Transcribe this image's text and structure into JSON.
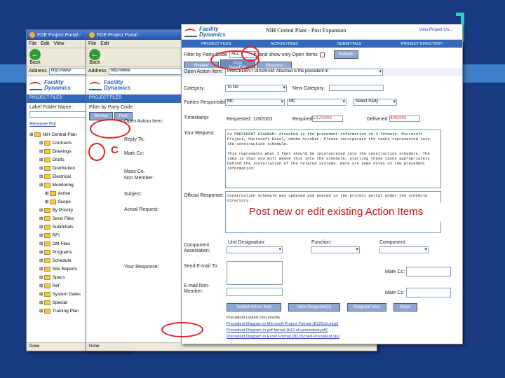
{
  "win1": {
    "title": "FDE Project Portal -",
    "menu": [
      "File",
      "Edit",
      "View"
    ],
    "back": "Back",
    "address": "Address",
    "url": "http://www",
    "logo1": "Facility",
    "logo2": "Dynamics",
    "nav": "PROJECT FILES",
    "label_folder": "Label Folder Name :",
    "remove": "Remove Fol",
    "tree": [
      "NIH Central Plan",
      "Contracts",
      "Drawings",
      "Drafts",
      "Distribution",
      "Electrical",
      "Monitoring",
      "Active",
      "Scope",
      "By Priority",
      "Send Files",
      "Submittals",
      "RFI",
      "DM Files",
      "Programs",
      "Schedule",
      "Site Reports",
      "Specs",
      "Ref",
      "System Dates",
      "Special",
      "Training Plan"
    ],
    "status": "Done"
  },
  "win2": {
    "title": "FDE Project Portal -",
    "menu": [
      "File",
      "Edit"
    ],
    "back": "Back",
    "address": "Address",
    "url": "http://www",
    "logo1": "Facility",
    "logo2": "Dynamics",
    "nav": "PROJECT FILES",
    "filter": "Filter by Party Code",
    "review": "Review",
    "post": "Post",
    "letter_c": "C",
    "status": "Done",
    "labels": [
      "Open Action Item:",
      "Reply To:",
      "Mark Co:",
      "Mass Co.\nNon Member:",
      "Subject:",
      "Actual Request:",
      "Your Response:"
    ]
  },
  "win3": {
    "title": "NIH Central Plant - Post Expansion",
    "view_project": "View Project Un...",
    "logo1": "Facility",
    "logo2": "Dynamics",
    "nav": [
      "PROJECT FILES",
      "ACTION ITEMS",
      "SUBMITTALS",
      "PROJECT DIRECTORY"
    ],
    "filter_label": "Filter by Party Code",
    "filter_val": "ALL",
    "open_label": "and show only Open Items",
    "refresh": "Refresh",
    "tabs": [
      "Review",
      "Post New/Edit",
      "Respond"
    ],
    "open_item_label": "Open Action Item:",
    "open_item_val": "PRECEDENT DIAGRAM: Attached is the precedent in",
    "category_label": "Category:",
    "category_val": "To Do",
    "new_category_label": "New Category:",
    "parties_label": "Parties Responsible:",
    "party1": "MC",
    "party2": "MC",
    "party3": "Select Party",
    "timestamp_label": "Timestamp:",
    "requested": "Requested: 1/3/2003",
    "required_label": "Required",
    "required_val": "1/17/2003",
    "delivered_label": "Delivered",
    "delivered_val": "4/4/2003",
    "request_label": "Your Request:",
    "request_text": "Cx PRECEDENT DIAGRAM: Attached is the precedent information in 3 formats: Microsoft Project, Microsoft Excel, Adobe Acrobat. Please incorporate the tasks represented into the construction schedule.\n\nThis represents what I feel should be incorporated into the construction schedule. The idea is that you will weave this into the schedule, starting these tasks appropriately behind the installation of the related systems. Here are some notes on the precedent information:",
    "official_label": "Official Response:",
    "official_text": "Construction schedule was updated and posted in the project portal under the schedule directory.",
    "component_label": "Component Association:",
    "unit_label": "Unit Designation:",
    "function_label": "Function:",
    "component_col": "Component:",
    "send_email_label": "Send E-mail To:",
    "mark_cc_label": "Mark Cc:",
    "email_non_label": "E-mail Non-Member:",
    "mark_cc2_label": "Mark Cc:",
    "buttons": [
      "Submit Action Item",
      "View Response(s)",
      "Respond Now",
      "Reset"
    ],
    "linked_label": "Precedent Linked Documents",
    "links": [
      "Precedent Diagram in Microsoft Project Format (B12Sch.mpp)",
      "Precedent Diagram in pdf format (b12 sh-precedent.pdf)",
      "Precedent Diagram in Excel Format (B12Sched-Precedent.xls)"
    ]
  },
  "callout": "Post new or edit existing Action Items",
  "colors": {
    "background": "#173a80",
    "stripe": "#3f7fc7",
    "accent": "#2fd0c8",
    "highlight": "#e02020"
  }
}
